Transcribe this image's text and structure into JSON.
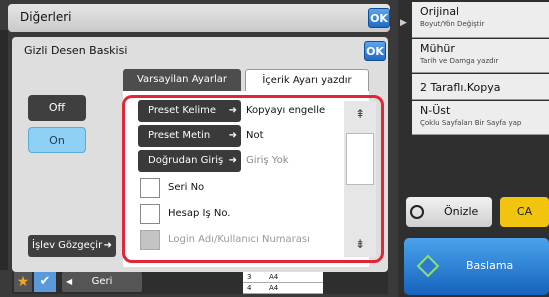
{
  "window": {
    "title": "Diğerleri",
    "ok_label": "OK"
  },
  "dialog": {
    "title": "Gizli Desen Baskisi",
    "ok_label": "OK",
    "tabs": [
      {
        "label": "Varsayilan Ayarlar",
        "active": false
      },
      {
        "label": "İçerik Ayarı yazdır",
        "active": true
      }
    ],
    "toggle": {
      "off_label": "Off",
      "on_label": "On",
      "selected": "On"
    },
    "function_check_label": "İşlev Gözgeçir",
    "rows": [
      {
        "button": "Preset Kelime",
        "value": "Kopyayı engelle",
        "enabled": true
      },
      {
        "button": "Preset Metin",
        "value": "Not",
        "enabled": true
      },
      {
        "button": "Doğrudan Giriş",
        "value": "Giriş Yok",
        "enabled": true
      }
    ],
    "checkboxes": [
      {
        "label": "Seri No",
        "checked": false,
        "enabled": true
      },
      {
        "label": "Hesap Iş No.",
        "checked": false,
        "enabled": true
      },
      {
        "label": "Login Adı/Kullanıcı Numarası",
        "checked": false,
        "enabled": false
      }
    ]
  },
  "right_panel": {
    "items": [
      {
        "main": "Orijinal",
        "sub": "Boyut/Yön Değiştir"
      },
      {
        "main": "Mühür",
        "sub": "Tarih ve Damga yazdır"
      },
      {
        "main": "2 Taraflı.Kopya",
        "sub": ""
      },
      {
        "main": "N-Üst",
        "sub": "Çoklu Sayfaları Bir Sayfa yap"
      }
    ],
    "preview_label": "Önizle",
    "ca_label": "CA",
    "start_label": "Baslama"
  },
  "bottom": {
    "back_label": "Geri",
    "mini_table": [
      {
        "num": "3",
        "size": "A4"
      },
      {
        "num": "4",
        "size": "A4"
      }
    ]
  },
  "colors": {
    "accent": "#1f6cc4",
    "highlight": "#e32636",
    "ca": "#f1c40f",
    "on": "#8fd0f5"
  }
}
